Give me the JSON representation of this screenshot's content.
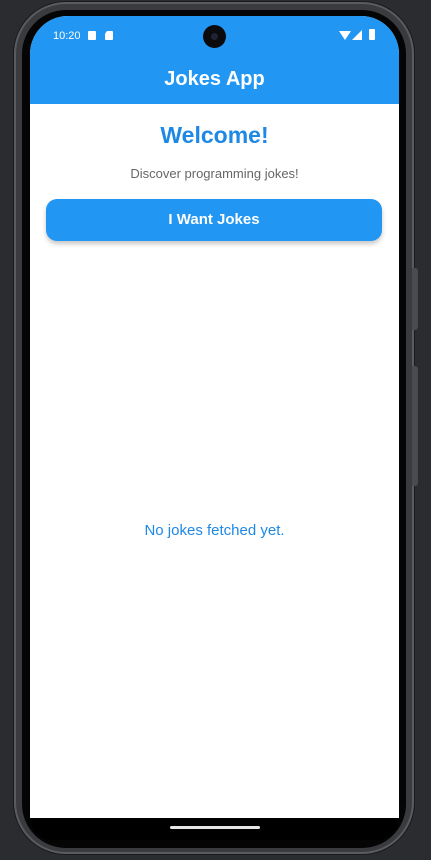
{
  "status_bar": {
    "time": "10:20",
    "left_icons": [
      "a-icon",
      "sd-card-icon"
    ],
    "right_icons": [
      "wifi-icon",
      "signal-icon",
      "battery-icon"
    ]
  },
  "app_bar": {
    "title": "Jokes App"
  },
  "main": {
    "welcome": "Welcome!",
    "subtitle": "Discover programming jokes!",
    "fetch_button_label": "I Want Jokes",
    "empty_state": "No jokes fetched yet."
  },
  "colors": {
    "primary": "#2196f3",
    "heading_blue": "#1e88e5",
    "subtitle_gray": "#666666",
    "background": "#ffffff"
  }
}
